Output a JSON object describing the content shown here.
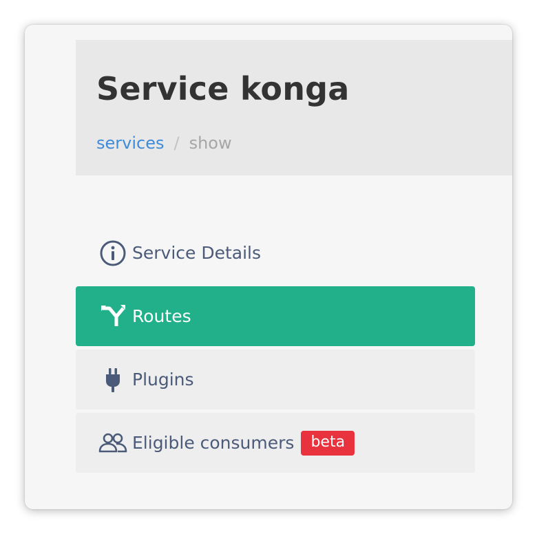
{
  "header": {
    "title": "Service konga",
    "breadcrumb": {
      "parent": "services",
      "separator": "/",
      "current": "show"
    }
  },
  "nav": {
    "items": [
      {
        "label": "Service Details",
        "icon": "info-circle-icon",
        "active": false
      },
      {
        "label": "Routes",
        "icon": "route-fork-icon",
        "active": true
      },
      {
        "label": "Plugins",
        "icon": "plug-icon",
        "active": false
      },
      {
        "label": "Eligible consumers",
        "icon": "users-icon",
        "active": false,
        "badge": "beta"
      }
    ]
  },
  "colors": {
    "active_bg": "#21b08a",
    "link": "#3d8bd9",
    "badge": "#e8323e",
    "nav_text": "#4a5a78",
    "title": "#333333"
  }
}
